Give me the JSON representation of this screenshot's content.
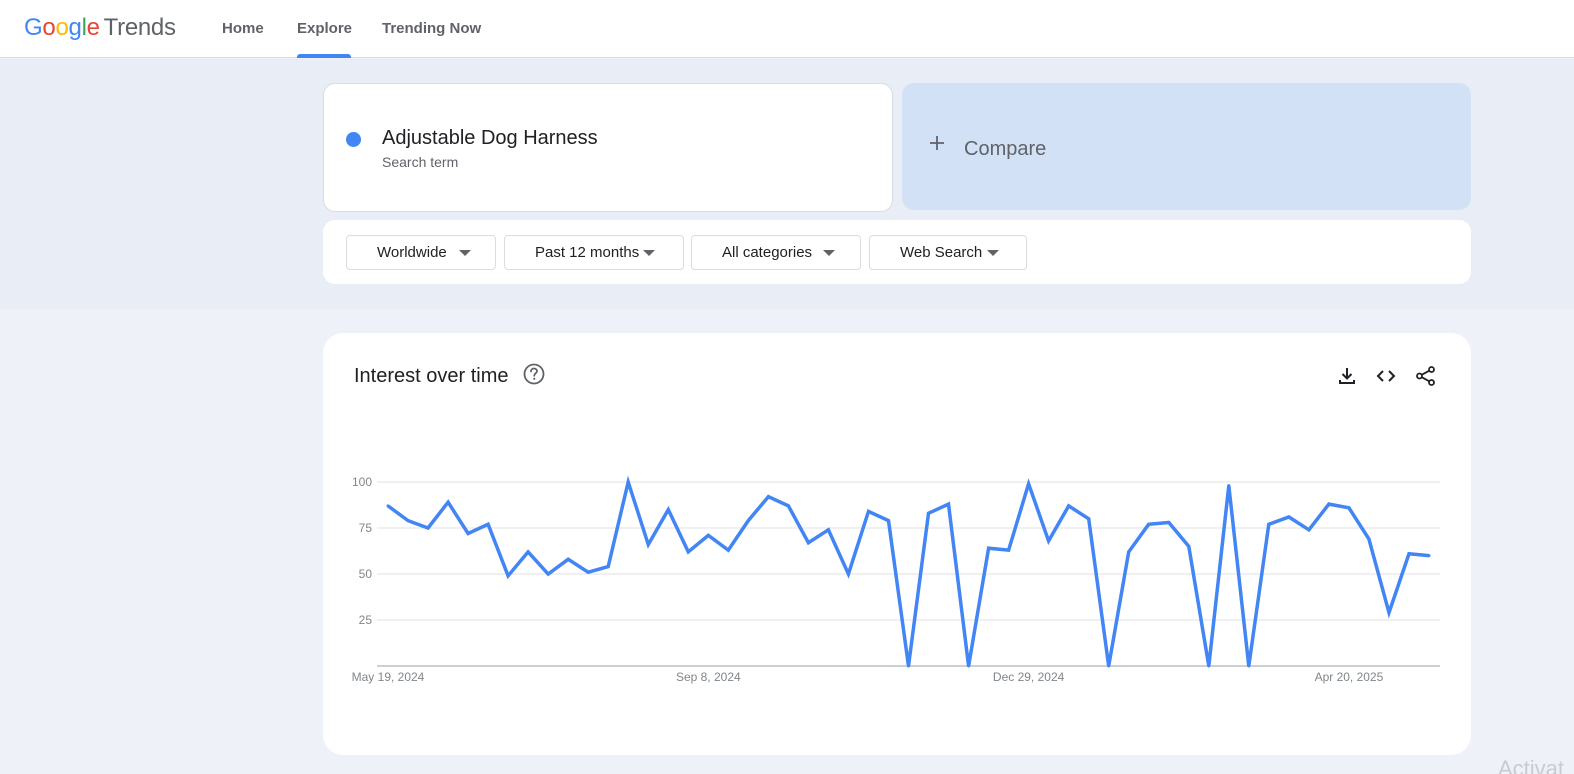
{
  "header": {
    "logo_letters": [
      "G",
      "o",
      "o",
      "g",
      "l",
      "e"
    ],
    "logo_suffix": "Trends",
    "nav": [
      {
        "label": "Home"
      },
      {
        "label": "Explore"
      },
      {
        "label": "Trending Now"
      }
    ],
    "active_nav": "Explore"
  },
  "search": {
    "term": "Adjustable Dog Harness",
    "term_type": "Search term",
    "term_color": "#4285f4",
    "compare_label": "Compare"
  },
  "filters": {
    "region": "Worldwide",
    "time_range": "Past 12 months",
    "category": "All categories",
    "search_type": "Web Search"
  },
  "chart_card": {
    "title": "Interest over time",
    "icons": [
      "help-icon",
      "download-icon",
      "embed-icon",
      "share-icon"
    ]
  },
  "chart_data": {
    "type": "line",
    "title": "Interest over time",
    "xlabel": "",
    "ylabel": "",
    "ylim": [
      0,
      100
    ],
    "yticks": [
      25,
      50,
      75,
      100
    ],
    "grid": true,
    "x_tick_labels": [
      "May 19, 2024",
      "Sep 8, 2024",
      "Dec 29, 2024",
      "Apr 20, 2025"
    ],
    "x_tick_indices": [
      0,
      16,
      32,
      48
    ],
    "series": [
      {
        "name": "Adjustable Dog Harness",
        "color": "#4285f4",
        "values": [
          87,
          79,
          75,
          89,
          72,
          77,
          49,
          62,
          50,
          58,
          51,
          54,
          100,
          66,
          85,
          62,
          71,
          63,
          79,
          92,
          87,
          67,
          74,
          50,
          84,
          79,
          0,
          83,
          88,
          0,
          64,
          63,
          99,
          68,
          87,
          80,
          0,
          62,
          77,
          78,
          65,
          0,
          98,
          0,
          77,
          81,
          74,
          88,
          86,
          69,
          29,
          61,
          60
        ]
      }
    ]
  },
  "watermark": "Activat"
}
